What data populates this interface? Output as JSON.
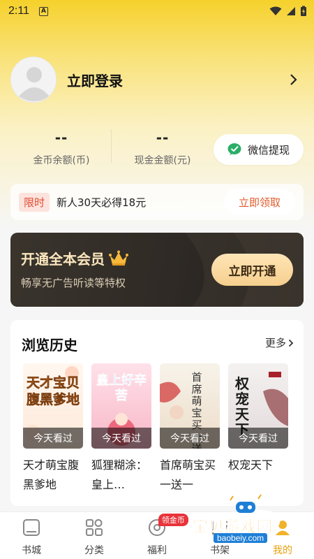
{
  "status_bar": {
    "time": "2:11",
    "notif_letter": "A"
  },
  "profile": {
    "login_label": "立即登录"
  },
  "balances": {
    "gold_value": "--",
    "gold_label": "金币余额(币)",
    "cash_value": "--",
    "cash_label": "现金金额(元)",
    "wechat_button": "微信提现"
  },
  "promo": {
    "tag": "限时",
    "text": "新人30天必得18元",
    "button": "立即领取"
  },
  "vip": {
    "title": "开通全本会员",
    "subtitle": "畅享无广告听读等特权",
    "button": "立即开通"
  },
  "history": {
    "title": "浏览历史",
    "more": "更多",
    "books": [
      {
        "title": "天才萌宝腹黑爹地",
        "badge": "今天看过",
        "cover_text": "天才宝贝腹黑爹地"
      },
      {
        "title": "狐狸糊涂：皇上…",
        "badge": "今天看过",
        "cover_text": "皇上好辛苦"
      },
      {
        "title": "首席萌宝买一送一",
        "badge": "今天看过",
        "cover_text": "首席萌宝买一送"
      },
      {
        "title": "权宠天下",
        "badge": "今天看过",
        "cover_text": "权宠天下"
      }
    ]
  },
  "nav": {
    "items": [
      {
        "label": "书城",
        "icon": "bookstore-icon"
      },
      {
        "label": "分类",
        "icon": "category-grid-icon"
      },
      {
        "label": "福利",
        "icon": "welfare-icon",
        "badge": "领金币"
      },
      {
        "label": "书架",
        "icon": "bookshelf-icon"
      },
      {
        "label": "我的",
        "icon": "profile-icon"
      }
    ]
  },
  "watermark": {
    "text": "宝贝游戏网",
    "url": "baobeiy.com"
  },
  "colors": {
    "accent": "#f6d12c",
    "nav_active": "#e8a210",
    "promo_red": "#e24c33",
    "vip_gold": "#fbe7be"
  }
}
